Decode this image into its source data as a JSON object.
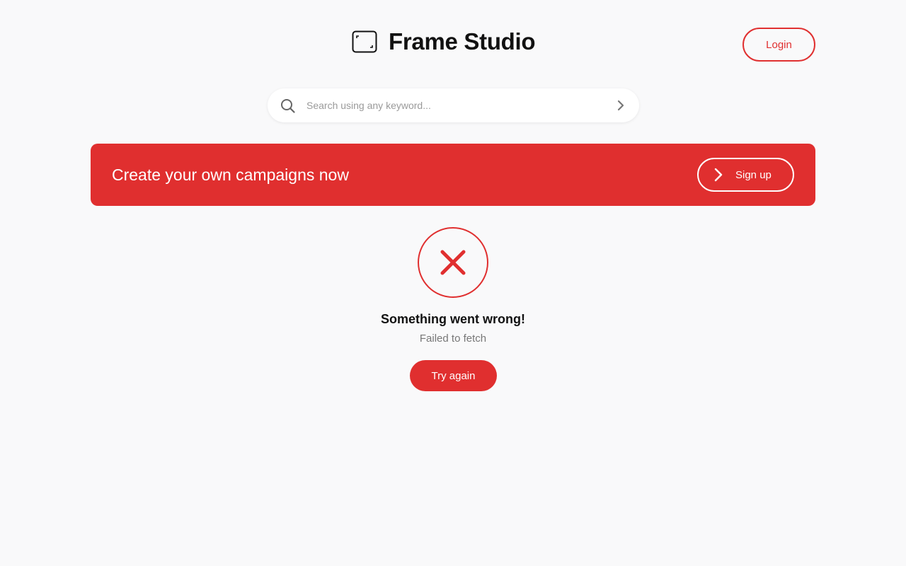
{
  "header": {
    "brand": "Frame Studio",
    "logo_icon": "frame-icon",
    "login_label": "Login"
  },
  "search": {
    "placeholder": "Search using any keyword...",
    "value": "",
    "icon": "search-icon",
    "submit_icon": "chevron-right-icon"
  },
  "banner": {
    "text": "Create your own campaigns now",
    "signup_label": "Sign up",
    "signup_icon": "chevron-right-icon"
  },
  "error": {
    "icon": "error-x-icon",
    "title": "Something went wrong!",
    "message": "Failed to fetch",
    "retry_label": "Try again"
  },
  "colors": {
    "accent": "#e02f2f",
    "background": "#f9f9fa",
    "text": "#111111",
    "muted": "#777777"
  }
}
